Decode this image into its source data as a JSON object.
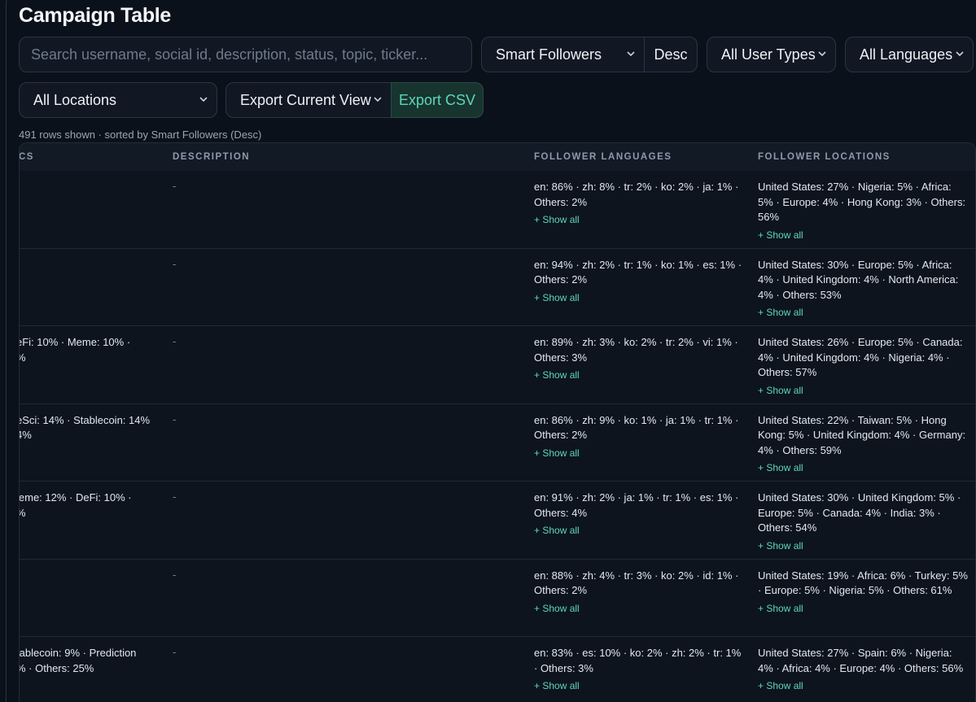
{
  "title": "Campaign Table",
  "search": {
    "placeholder": "Search username, social id, description, status, topic, ticker..."
  },
  "controls": {
    "sort_by": "Smart Followers",
    "sort_dir": "Desc",
    "user_types": "All User Types",
    "languages": "All Languages",
    "locations": "All Locations",
    "export_scope": "Export Current View",
    "export_button": "Export CSV"
  },
  "meta": "491 rows shown · sorted by Smart Followers (Desc)",
  "columns": {
    "topics": "CS",
    "description": "DESCRIPTION",
    "languages": "FOLLOWER LANGUAGES",
    "locations": "FOLLOWER LOCATIONS"
  },
  "show_all_label": "+ Show all",
  "rows": [
    {
      "topics": [
        "",
        ""
      ],
      "description": "-",
      "languages": "en: 86% · zh: 8% · tr: 2% · ko: 2% · ja: 1% · Others: 2%",
      "locations": "United States: 27% · Nigeria: 5% · Africa: 5% · Europe: 4% · Hong Kong: 3% · Others: 56%"
    },
    {
      "topics": [
        "",
        ""
      ],
      "description": "-",
      "languages": "en: 94% · zh: 2% · tr: 1% · ko: 1% · es: 1% · Others: 2%",
      "locations": "United States: 30% · Europe: 5% · Africa: 4% · United Kingdom: 4% · North America: 4% · Others: 53%"
    },
    {
      "topics": [
        "eFi: 10% · Meme: 10% ·",
        "%"
      ],
      "description": "-",
      "languages": "en: 89% · zh: 3% · ko: 2% · tr: 2% · vi: 1% · Others: 3%",
      "locations": "United States: 26% · Europe: 5% · Canada: 4% · United Kingdom: 4% · Nigeria: 4% · Others: 57%"
    },
    {
      "topics": [
        "eSci: 14% · Stablecoin: 14%",
        "4%"
      ],
      "description": "-",
      "languages": "en: 86% · zh: 9% · ko: 1% · ja: 1% · tr: 1% · Others: 2%",
      "locations": "United States: 22% · Taiwan: 5% · Hong Kong: 5% · United Kingdom: 4% · Germany: 4% · Others: 59%"
    },
    {
      "topics": [
        "leme: 12% · DeFi: 10% ·",
        "%"
      ],
      "description": "-",
      "languages": "en: 91% · zh: 2% · ja: 1% · tr: 1% · es: 1% · Others: 4%",
      "locations": "United States: 30% · United Kingdom: 5% · Europe: 5% · Canada: 4% · India: 3% · Others: 54%"
    },
    {
      "topics": [
        "",
        ""
      ],
      "description": "-",
      "languages": "en: 88% · zh: 4% · tr: 3% · ko: 2% · id: 1% · Others: 2%",
      "locations": "United States: 19% · Africa: 6% · Turkey: 5% · Europe: 5% · Nigeria: 5% · Others: 61%"
    },
    {
      "topics": [
        "tablecoin: 9% · Prediction",
        "% · Others: 25%"
      ],
      "description": "-",
      "languages": "en: 83% · es: 10% · ko: 2% · zh: 2% · tr: 1% · Others: 3%",
      "locations": "United States: 27% · Spain: 6% · Nigeria: 4% · Africa: 4% · Europe: 4% · Others: 56%"
    }
  ]
}
